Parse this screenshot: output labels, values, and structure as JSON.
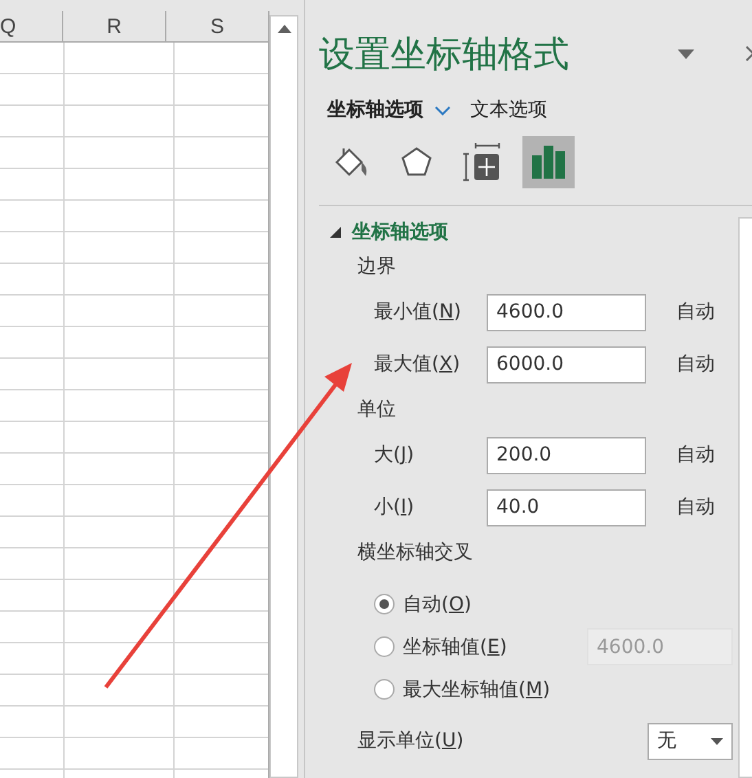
{
  "sheet": {
    "columns": [
      "Q",
      "R",
      "S"
    ]
  },
  "panel": {
    "title": "设置坐标轴格式",
    "tabs": [
      {
        "label": "坐标轴选项",
        "selected": true
      },
      {
        "label": "文本选项",
        "selected": false
      }
    ],
    "icon_tabs": [
      {
        "kind": "fill",
        "selected": false
      },
      {
        "kind": "effects",
        "selected": false
      },
      {
        "kind": "size",
        "selected": false
      },
      {
        "kind": "axis",
        "selected": true
      }
    ],
    "section": {
      "title": "坐标轴选项",
      "expanded": true,
      "groups": [
        {
          "title": "边界",
          "rows": [
            {
              "label_parts": [
                "最小值(",
                "N",
                ")"
              ],
              "value": "4600.0",
              "reset": "自动"
            },
            {
              "label_parts": [
                "最大值(",
                "X",
                ")"
              ],
              "value": "6000.0",
              "reset": "自动"
            }
          ]
        },
        {
          "title": "单位",
          "rows": [
            {
              "label_parts": [
                "大(",
                "J",
                ")"
              ],
              "value": "200.0",
              "reset": "自动"
            },
            {
              "label_parts": [
                "小(",
                "I",
                ")"
              ],
              "value": "40.0",
              "reset": "自动"
            }
          ]
        }
      ],
      "crosses": {
        "title": "横坐标轴交叉",
        "options": [
          {
            "label_parts": [
              "自动(",
              "O",
              ")"
            ],
            "selected": true
          },
          {
            "label_parts": [
              "坐标轴值(",
              "E",
              ")"
            ],
            "selected": false,
            "value": "4600.0",
            "disabled": true
          },
          {
            "label_parts": [
              "最大坐标轴值(",
              "M",
              ")"
            ],
            "selected": false
          }
        ]
      },
      "display_units": {
        "label_parts": [
          "显示单位(",
          "U",
          ")"
        ],
        "value": "无"
      }
    }
  }
}
